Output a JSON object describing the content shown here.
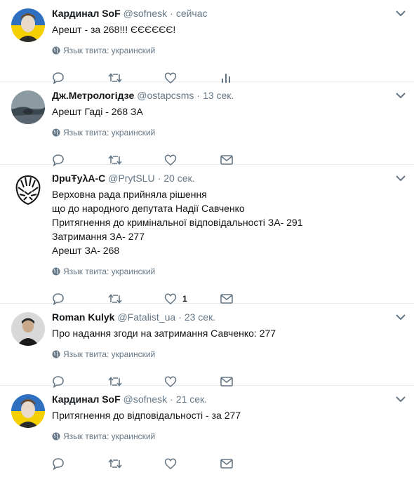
{
  "lang_label": "Язык твита: украинский",
  "tweets": [
    {
      "name": "Кардинал SoF",
      "handle": "@sofnesk",
      "time": "сейчас",
      "lines": [
        "Арешт - за 268!!! ЄЄЄЄЄЄ!"
      ],
      "last_action": "analytics-icon",
      "like_count": ""
    },
    {
      "name": "Дж.Метрологідзе",
      "handle": "@ostapcsms",
      "time": "13 сек.",
      "lines": [
        "Арешт Гаді - 268 ЗА"
      ],
      "last_action": "mail-icon",
      "like_count": ""
    },
    {
      "name": "ŊpuŦуλA-C",
      "handle": "@PrytSLU",
      "time": "20 сек.",
      "lines": [
        "Верховна рада прийняла рішення",
        "що до народного депутата Надії Савченко",
        "Притягнення до кримінальної відповідальності ЗА- 291",
        "Затримання ЗА- 277",
        "Арешт ЗА- 268"
      ],
      "last_action": "mail-icon",
      "like_count": "1"
    },
    {
      "name": "Roman Kulyk",
      "handle": "@Fatalist_ua",
      "time": "23 сек.",
      "lines": [
        "Про надання згоди на затримання Савченко: 277"
      ],
      "last_action": "mail-icon",
      "like_count": ""
    },
    {
      "name": "Кардинал SoF",
      "handle": "@sofnesk",
      "time": "21 сек.",
      "lines": [
        "Притягнення до відповідальності - за 277"
      ],
      "last_action": "mail-icon",
      "like_count": ""
    }
  ],
  "colors": {
    "icon": "#657786",
    "border": "#e6ecf0",
    "link": "#1da1f2"
  }
}
